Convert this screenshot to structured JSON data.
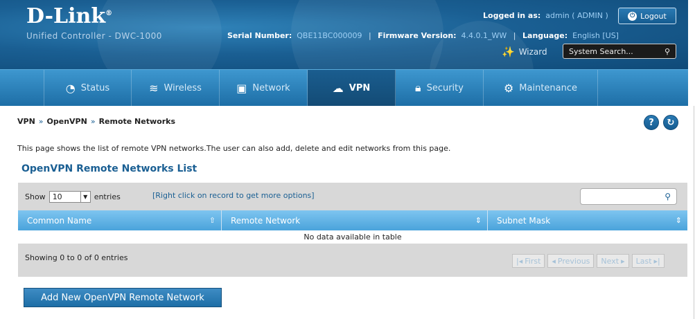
{
  "header": {
    "logo": "D-Link",
    "logo_mark": "®",
    "subtitle": "Unified Controller - DWC-1000",
    "logged_in_label": "Logged in as:",
    "logged_in_value": "admin ( ADMIN )",
    "logout_label": "Logout",
    "serial_label": "Serial Number:",
    "serial_value": "QBE11BC000009",
    "firmware_label": "Firmware Version:",
    "firmware_value": "4.4.0.1_WW",
    "language_label": "Language:",
    "language_value": "English [US]",
    "wizard_label": "Wizard",
    "search_placeholder": "System Search..."
  },
  "nav": {
    "items": [
      {
        "label": "Status",
        "icon": "gauge-icon"
      },
      {
        "label": "Wireless",
        "icon": "wifi-icon"
      },
      {
        "label": "Network",
        "icon": "monitor-icon"
      },
      {
        "label": "VPN",
        "icon": "cloud-lock-icon"
      },
      {
        "label": "Security",
        "icon": "lock-icon"
      },
      {
        "label": "Maintenance",
        "icon": "gears-icon"
      }
    ],
    "active": "VPN"
  },
  "breadcrumb": [
    "VPN",
    "OpenVPN",
    "Remote Networks"
  ],
  "breadcrumb_sep": "»",
  "description": "This page shows the list of remote VPN networks.The user can also add, delete and edit networks from this page.",
  "section_title": "OpenVPN Remote Networks List",
  "table": {
    "show_label": "Show",
    "show_value": "10",
    "entries_label": "entries",
    "hint": "[Right click on record to get more options]",
    "columns": [
      "Common Name",
      "Remote Network",
      "Subnet Mask"
    ],
    "empty_message": "No data available in table",
    "showing": "Showing 0 to 0 of 0 entries",
    "pager": {
      "first": "First",
      "previous": "Previous",
      "next": "Next",
      "last": "Last"
    }
  },
  "add_button": "Add New OpenVPN Remote Network"
}
